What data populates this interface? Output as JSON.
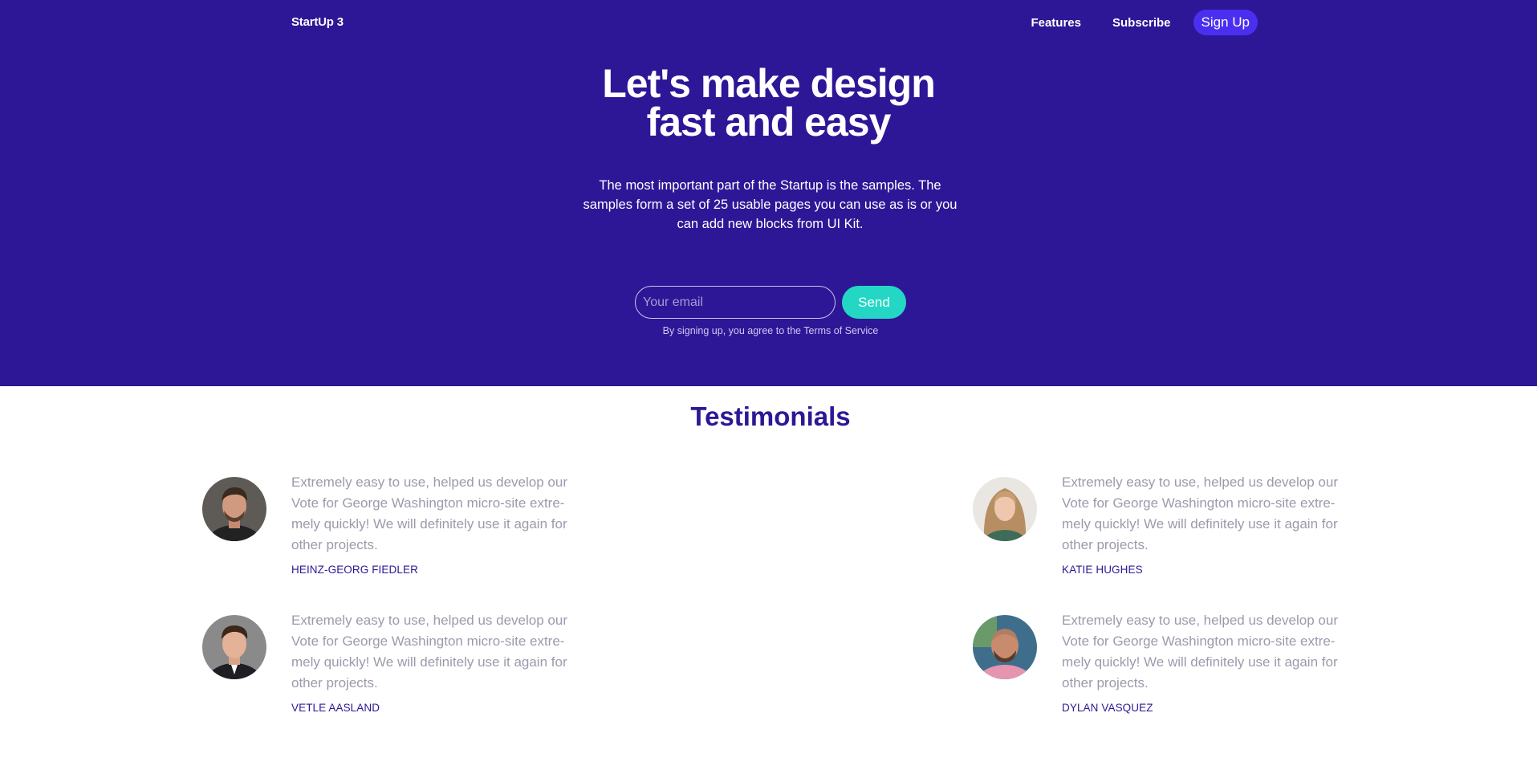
{
  "header": {
    "brand": "StartUp 3",
    "nav": [
      "Features",
      "Subscribe"
    ],
    "signup_label": "Sign Up"
  },
  "hero": {
    "title_line1": "Let's make design",
    "title_line2": "fast and easy",
    "subtitle": "The most important part of the Startup is the samples. The samples form a set of 25 usable pages you can use as is or you can add new blocks from UI Kit.",
    "email_placeholder": "Your email",
    "send_label": "Send",
    "terms": "By signing up, you agree to the Terms of Service"
  },
  "testimonials": {
    "title": "Testimonials",
    "items": [
      {
        "quote": "Extremely easy to use, helped us develop our Vote for George Washington micro-site extre-mely quickly! We will definitely use it again for other projects.",
        "author": "HEINZ-GEORG FIEDLER"
      },
      {
        "quote": "Extremely easy to use, helped us develop our Vote for George Washington micro-site extre-mely quickly! We will definitely use it again for other projects.",
        "author": "KATIE HUGHES"
      },
      {
        "quote": "Extremely easy to use, helped us develop our Vote for George Washington micro-site extre-mely quickly! We will definitely use it again for other projects.",
        "author": "VETLE AASLAND"
      },
      {
        "quote": "Extremely easy to use, helped us develop our Vote for George Washington micro-site extre-mely quickly! We will definitely use it again for other projects.",
        "author": "DYLAN VASQUEZ"
      }
    ]
  },
  "colors": {
    "hero_bg": "#2e1796",
    "accent_teal": "#23d7c4",
    "signup_bg": "#4b2ff0",
    "text_muted": "#9d9aab"
  }
}
